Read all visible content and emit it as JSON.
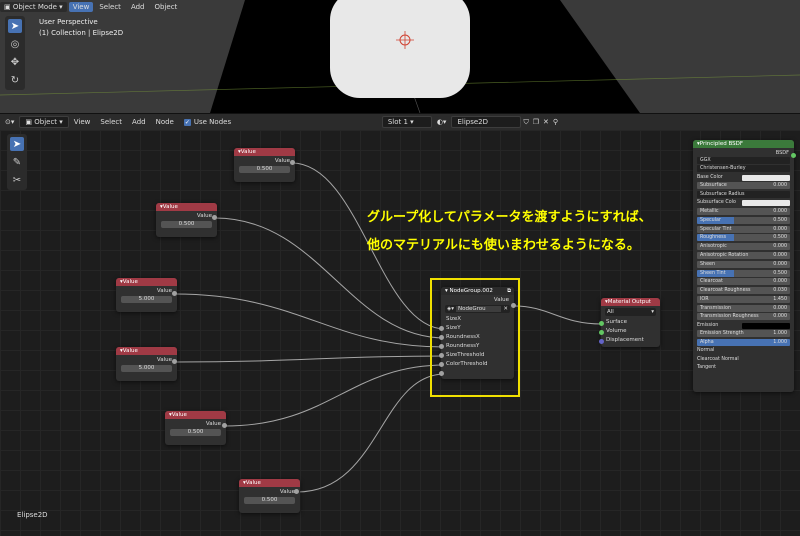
{
  "viewport": {
    "mode": "Object Mode",
    "menus": [
      "View",
      "Select",
      "Add",
      "Object"
    ],
    "info_line1": "User Perspective",
    "info_line2": "(1) Collection | Elipse2D"
  },
  "node_header": {
    "mode": "Object",
    "menus": [
      "View",
      "Select",
      "Add",
      "Node"
    ],
    "use_nodes_label": "Use Nodes",
    "slot": "Slot 1",
    "material": "Elipse2D"
  },
  "value_nodes": [
    {
      "title": "Value",
      "output": "Value",
      "value": "0.500"
    },
    {
      "title": "Value",
      "output": "Value",
      "value": "0.500"
    },
    {
      "title": "Value",
      "output": "Value",
      "value": "5.000"
    },
    {
      "title": "Value",
      "output": "Value",
      "value": "5.000"
    },
    {
      "title": "Value",
      "output": "Value",
      "value": "0.500"
    },
    {
      "title": "Value",
      "output": "Value",
      "value": "0.500"
    }
  ],
  "group_node": {
    "title": "NodeGroup.002",
    "output": "Value",
    "group_name": "NodeGrou",
    "inputs": [
      "SizeX",
      "SizeY",
      "RoundnessX",
      "RoundnessY",
      "SizeThreshold",
      "ColorThreshold"
    ]
  },
  "material_output": {
    "title": "Material Output",
    "target": "All",
    "inputs": [
      "Surface",
      "Volume",
      "Displacement"
    ]
  },
  "bsdf": {
    "title": "Principled BSDF",
    "output": "BSDF",
    "distribution": "GGX",
    "subsurface_method": "Christensen-Burley",
    "base_color_label": "Base Color",
    "subsurface": {
      "label": "Subsurface",
      "value": "0.000"
    },
    "subsurface_radius": "Subsurface Radius",
    "subsurface_color": "Subsurface Colo",
    "sliders": [
      {
        "label": "Metallic",
        "value": "0.000",
        "blue": false
      },
      {
        "label": "Specular",
        "value": "0.500",
        "blue": true
      },
      {
        "label": "Specular Tint",
        "value": "0.000",
        "blue": false
      },
      {
        "label": "Roughness",
        "value": "0.500",
        "blue": true
      },
      {
        "label": "Anisotropic",
        "value": "0.000",
        "blue": false
      },
      {
        "label": "Anisotropic Rotation",
        "value": "0.000",
        "blue": false
      },
      {
        "label": "Sheen",
        "value": "0.000",
        "blue": false
      },
      {
        "label": "Sheen Tint",
        "value": "0.500",
        "blue": true
      },
      {
        "label": "Clearcoat",
        "value": "0.000",
        "blue": false
      },
      {
        "label": "Clearcoat Roughness",
        "value": "0.030",
        "blue": false
      },
      {
        "label": "IOR",
        "value": "1.450",
        "blue": false
      },
      {
        "label": "Transmission",
        "value": "0.000",
        "blue": false
      },
      {
        "label": "Transmission Roughness",
        "value": "0.000",
        "blue": false
      }
    ],
    "emission_label": "Emission",
    "emission_strength": {
      "label": "Emission Strength",
      "value": "1.000"
    },
    "alpha": {
      "label": "Alpha",
      "value": "1.000"
    },
    "normal_label": "Normal",
    "clearcoat_normal_label": "Clearcoat Normal",
    "tangent_label": "Tangent"
  },
  "annotation": {
    "line1": "グループ化してパラメータを渡すようにすれば、",
    "line2": "他のマテリアルにも使いまわせるようになる。"
  },
  "footer_label": "Elipse2D",
  "colors": {
    "accent": "#4772b3",
    "value_header": "#a03a45",
    "bsdf_header": "#3b7a3b",
    "highlight": "#f0e000",
    "annotation": "#ffff00"
  }
}
